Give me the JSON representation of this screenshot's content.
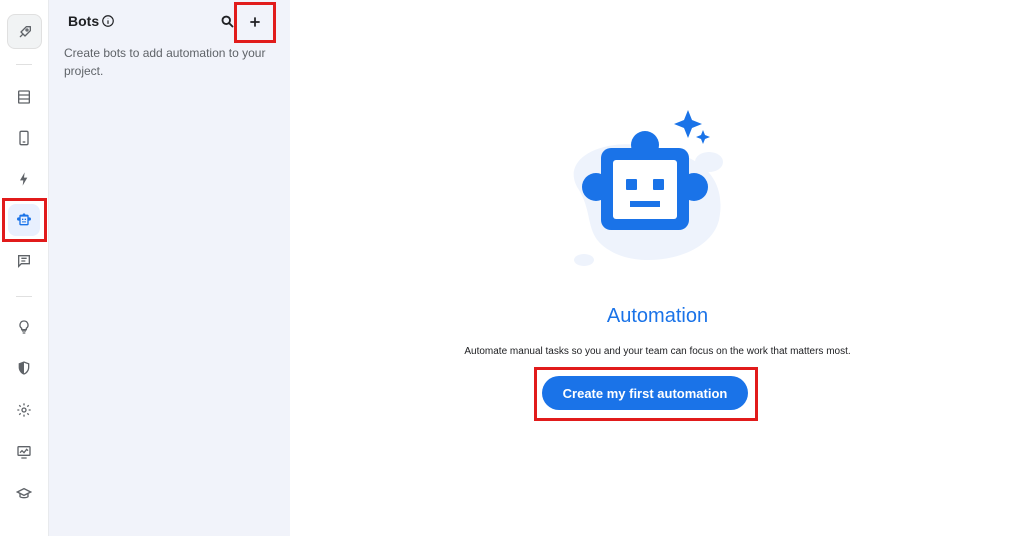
{
  "rail": {
    "items": [
      {
        "icon": "rocket-icon"
      },
      {
        "icon": "table-icon"
      },
      {
        "icon": "phone-icon"
      },
      {
        "icon": "lightning-icon"
      },
      {
        "icon": "bot-icon",
        "active": true
      },
      {
        "icon": "comment-icon"
      },
      {
        "icon": "lightbulb-icon"
      },
      {
        "icon": "shield-icon"
      },
      {
        "icon": "gear-icon"
      },
      {
        "icon": "monitor-chart-icon"
      },
      {
        "icon": "graduation-cap-icon"
      }
    ]
  },
  "panel": {
    "title": "Bots",
    "description": "Create bots to add automation to your project."
  },
  "main": {
    "title": "Automation",
    "description": "Automate manual tasks so you and your team can focus on the work that matters most.",
    "cta_label": "Create my first automation"
  },
  "colors": {
    "accent": "#1a73e8",
    "panel_bg": "#f1f3fa",
    "highlight": "#e11b1b"
  }
}
